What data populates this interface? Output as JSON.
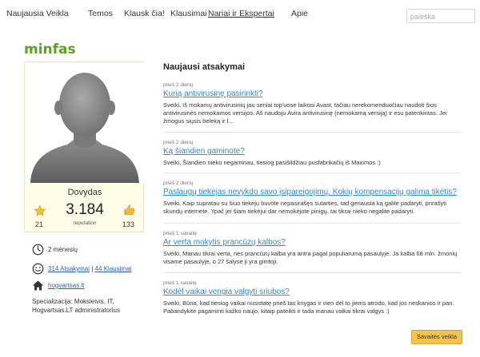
{
  "nav": {
    "items": [
      {
        "label": "Naujausia Veikla"
      },
      {
        "label": "Temos"
      },
      {
        "label": "Klausk čia!"
      },
      {
        "label": "Klausimai"
      },
      {
        "label": "Nariai ir Ekspertai"
      },
      {
        "label": "Apie"
      }
    ],
    "active": "Nariai ir Ekspertai",
    "search_placeholder": "paieška"
  },
  "profile": {
    "username": "minfas",
    "display_name": "Dovydas",
    "reputation": "3.184",
    "reputation_label": "reputation",
    "stars": "21",
    "likes": "133",
    "member_for": "2 mėnesių",
    "answers_link": "314 Atsakymai",
    "questions_link": "44 Klausimai",
    "separator": "|",
    "website": "hogvartsas.lt",
    "specialization": "Specializacija: Moksleivis, IT, Hogvartsas.LT administratorius"
  },
  "answers": {
    "title": "Naujausi atsakymai",
    "items": [
      {
        "time": "prieš 2 dienų",
        "question": "Kurią antivirusinę pasirinkti?",
        "body": "Sveiki, Iš mokamų antivirusinių jau seniai top'uose laikosi Avast, tačiau nerekomenduočiau naudoti šios antivirusinės nemokamos versijos. Aš naudoju Avira antivirusinę (nemokamą versiją) ir esu patenkintas. Jei žmogus siųsis beleką ir l..."
      },
      {
        "time": "prieš 2 dienų",
        "question": "Ką šiandien gaminote?",
        "body": "Sveiki, Šiandien nieko negaminau, tiesiog pasišildžiau pusfabrikačių iš Maximos :)"
      },
      {
        "time": "prieš 2 dienų",
        "question": "Paslaugų tiekėjas nevykdo savo įsipareigojimų. Kokių kompensacijų galima tikėtis?",
        "body": "Sveiki, Kaip supratau su šiuo tiekėju buvote nepasirašęs sutarties, tad geriausia ką galite padaryti, prirašyti skundų internete. Ypač jei šiam tiekėjui dar nemokėjote pinigų, tai tikrai nieko negalite padaryti."
      },
      {
        "time": "prieš 1 savaitę",
        "question": "Ar verta mokytis prancūzų kalbos?",
        "body": "Sveiki, Manau tikrai verta, nes prancūzų kalba yra antra pagal populiarumą pasaulyje. Ja kalba 68 mln. žmonių visame pasaulyje, o 27 šalyse ji yra gimtoji."
      },
      {
        "time": "prieš 1 savaitę",
        "question": "Kodėl vaikai vengia valgyti sriubos?",
        "body": "Sveiki, Būna, kad tiesiog vaikai nusistatę prieš tas knygas ir vien dėl to jiems atrodo, kad jos neskanios ir pan. Pabandykite pagaminti kažko naujo, kitaip pateikti ir tada manau vaikai tikrai valgys :)"
      }
    ],
    "more_button": "Savaitės veikla"
  },
  "colors": {
    "username": "#5aa21e",
    "link": "#2b88d0",
    "card_bg": "#fdfde8",
    "button": "#f2c24a"
  }
}
